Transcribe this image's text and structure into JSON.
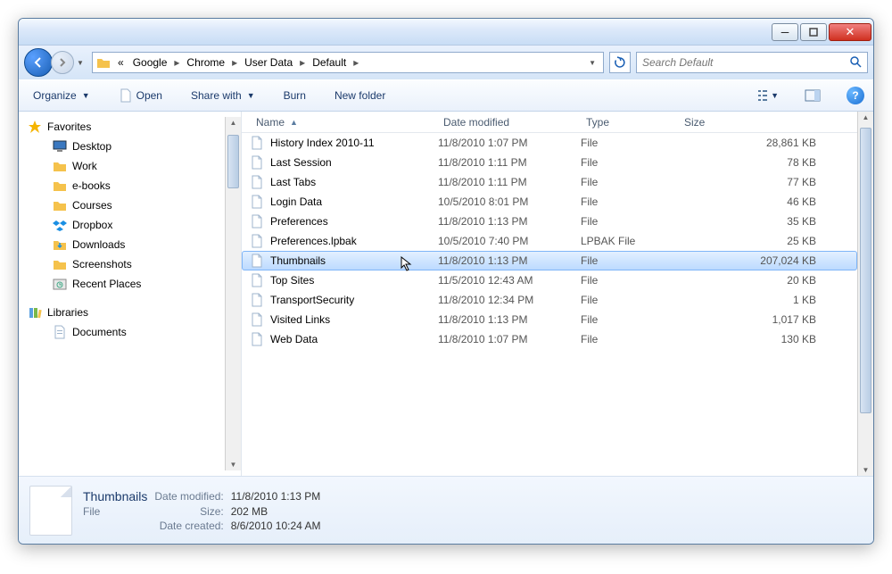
{
  "titlebar": {
    "min": "–",
    "max": "▢",
    "close": "✕"
  },
  "breadcrumb": {
    "overflow": "«",
    "items": [
      "Google",
      "Chrome",
      "User Data",
      "Default"
    ]
  },
  "search": {
    "placeholder": "Search Default"
  },
  "toolbar": {
    "organize": "Organize",
    "open": "Open",
    "share": "Share with",
    "burn": "Burn",
    "newfolder": "New folder"
  },
  "columns": {
    "name": "Name",
    "date": "Date modified",
    "type": "Type",
    "size": "Size"
  },
  "sidebar": {
    "favorites": {
      "label": "Favorites",
      "items": [
        {
          "label": "Desktop",
          "icon": "desktop"
        },
        {
          "label": "Work",
          "icon": "folder"
        },
        {
          "label": "e-books",
          "icon": "folder"
        },
        {
          "label": "Courses",
          "icon": "folder"
        },
        {
          "label": "Dropbox",
          "icon": "dropbox"
        },
        {
          "label": "Downloads",
          "icon": "downloads"
        },
        {
          "label": "Screenshots",
          "icon": "folder"
        },
        {
          "label": "Recent Places",
          "icon": "recent"
        }
      ]
    },
    "libraries": {
      "label": "Libraries",
      "items": [
        {
          "label": "Documents",
          "icon": "documents"
        }
      ]
    }
  },
  "files": [
    {
      "name": "History Index 2010-11",
      "date": "11/8/2010 1:07 PM",
      "type": "File",
      "size": "28,861 KB",
      "selected": false
    },
    {
      "name": "Last Session",
      "date": "11/8/2010 1:11 PM",
      "type": "File",
      "size": "78 KB",
      "selected": false
    },
    {
      "name": "Last Tabs",
      "date": "11/8/2010 1:11 PM",
      "type": "File",
      "size": "77 KB",
      "selected": false
    },
    {
      "name": "Login Data",
      "date": "10/5/2010 8:01 PM",
      "type": "File",
      "size": "46 KB",
      "selected": false
    },
    {
      "name": "Preferences",
      "date": "11/8/2010 1:13 PM",
      "type": "File",
      "size": "35 KB",
      "selected": false
    },
    {
      "name": "Preferences.lpbak",
      "date": "10/5/2010 7:40 PM",
      "type": "LPBAK File",
      "size": "25 KB",
      "selected": false
    },
    {
      "name": "Thumbnails",
      "date": "11/8/2010 1:13 PM",
      "type": "File",
      "size": "207,024 KB",
      "selected": true
    },
    {
      "name": "Top Sites",
      "date": "11/5/2010 12:43 AM",
      "type": "File",
      "size": "20 KB",
      "selected": false
    },
    {
      "name": "TransportSecurity",
      "date": "11/8/2010 12:34 PM",
      "type": "File",
      "size": "1 KB",
      "selected": false
    },
    {
      "name": "Visited Links",
      "date": "11/8/2010 1:13 PM",
      "type": "File",
      "size": "1,017 KB",
      "selected": false
    },
    {
      "name": "Web Data",
      "date": "11/8/2010 1:07 PM",
      "type": "File",
      "size": "130 KB",
      "selected": false
    }
  ],
  "details": {
    "name": "Thumbnails",
    "type": "File",
    "labels": {
      "modified": "Date modified:",
      "size": "Size:",
      "created": "Date created:"
    },
    "modified": "11/8/2010 1:13 PM",
    "size": "202 MB",
    "created": "8/6/2010 10:24 AM"
  }
}
